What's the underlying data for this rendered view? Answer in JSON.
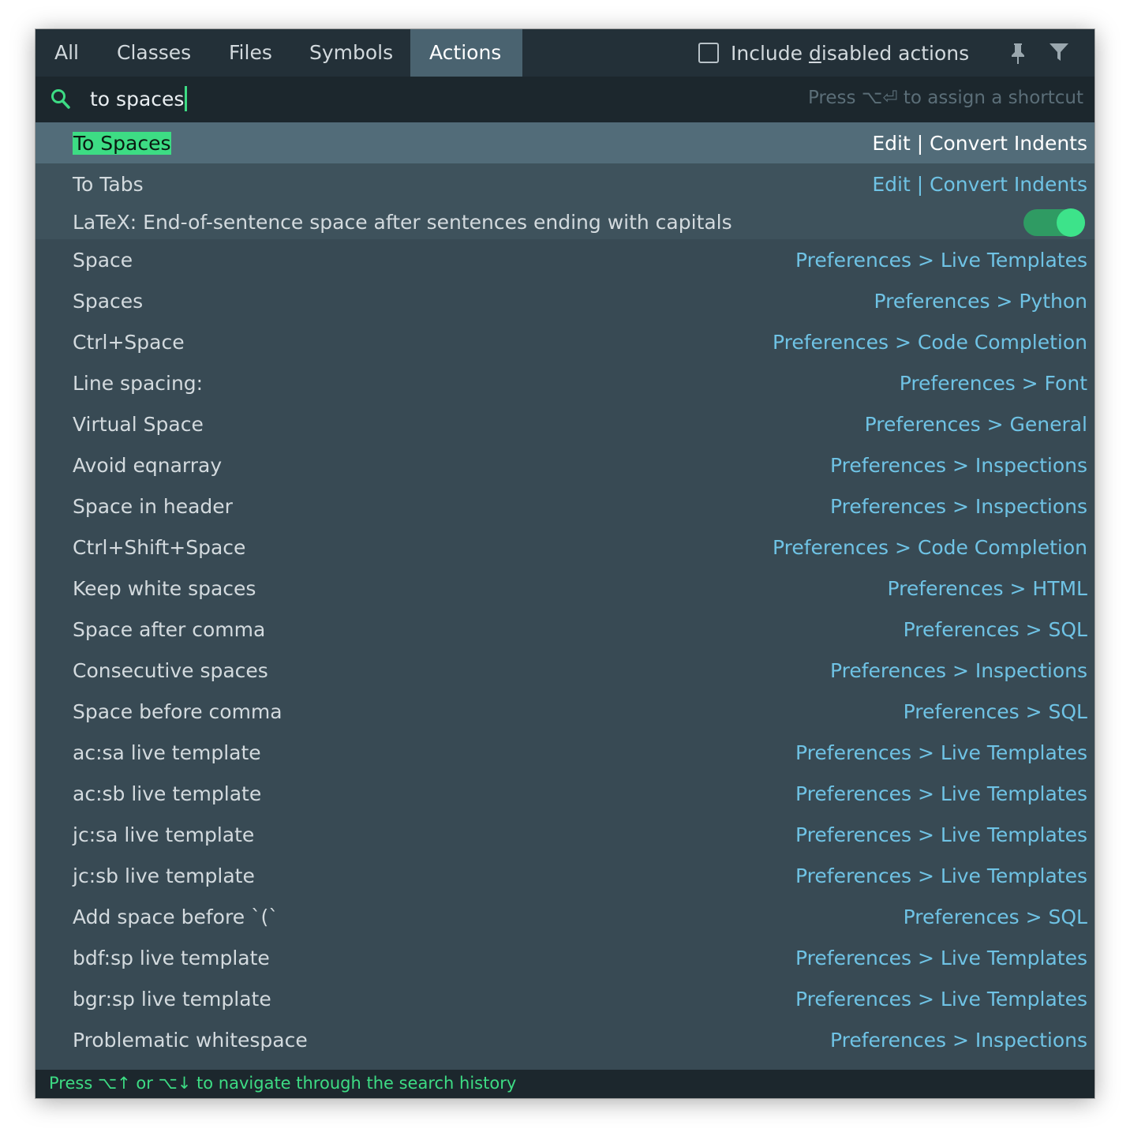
{
  "tabs": [
    {
      "label": "All"
    },
    {
      "label": "Classes"
    },
    {
      "label": "Files"
    },
    {
      "label": "Symbols"
    },
    {
      "label": "Actions",
      "active": true
    }
  ],
  "include_disabled": {
    "label_before": "Include ",
    "label_mnemonic": "d",
    "label_after": "isabled actions",
    "checked": false
  },
  "toolbar_icons": [
    "pin-icon",
    "filter-icon"
  ],
  "search": {
    "icon": "search-icon",
    "value": "to spaces",
    "hint": "Press ⌥⏎ to assign a shortcut"
  },
  "results": [
    {
      "name": "To Spaces",
      "path": "Edit | Convert Indents",
      "selected": true
    },
    {
      "name": "To Tabs",
      "path": "Edit | Convert Indents"
    },
    {
      "name": "LaTeX: End-of-sentence space after sentences ending with capitals",
      "toggle": true,
      "toggle_on": true
    },
    {
      "name": "Space",
      "path": "Preferences > Live Templates"
    },
    {
      "name": "Spaces",
      "path": "Preferences > Python"
    },
    {
      "name": "Ctrl+Space",
      "path": "Preferences > Code Completion"
    },
    {
      "name": "Line spacing:",
      "path": "Preferences > Font"
    },
    {
      "name": "Virtual Space",
      "path": "Preferences > General"
    },
    {
      "name": "Avoid eqnarray",
      "path": "Preferences > Inspections"
    },
    {
      "name": "Space in header",
      "path": "Preferences > Inspections"
    },
    {
      "name": "Ctrl+Shift+Space",
      "path": "Preferences > Code Completion"
    },
    {
      "name": "Keep white spaces",
      "path": "Preferences > HTML"
    },
    {
      "name": "Space after comma",
      "path": "Preferences > SQL"
    },
    {
      "name": "Consecutive spaces",
      "path": "Preferences > Inspections"
    },
    {
      "name": "Space before comma",
      "path": "Preferences > SQL"
    },
    {
      "name": "ac:sa live template",
      "path": "Preferences > Live Templates"
    },
    {
      "name": "ac:sb live template",
      "path": "Preferences > Live Templates"
    },
    {
      "name": "jc:sa live template",
      "path": "Preferences > Live Templates"
    },
    {
      "name": "jc:sb live template",
      "path": "Preferences > Live Templates"
    },
    {
      "name": "Add space before `(`",
      "path": "Preferences > SQL"
    },
    {
      "name": "bdf:sp live template",
      "path": "Preferences > Live Templates"
    },
    {
      "name": "bgr:sp live template",
      "path": "Preferences > Live Templates"
    },
    {
      "name": "Problematic whitespace",
      "path": "Preferences > Inspections"
    }
  ],
  "status": {
    "text": "Press ⌥↑ or ⌥↓ to navigate through the search history"
  },
  "colors": {
    "accent_green": "#3ddc84",
    "path_blue": "#6fc3e5",
    "panel_bg": "#384a54",
    "selected_bg": "#526c79"
  }
}
